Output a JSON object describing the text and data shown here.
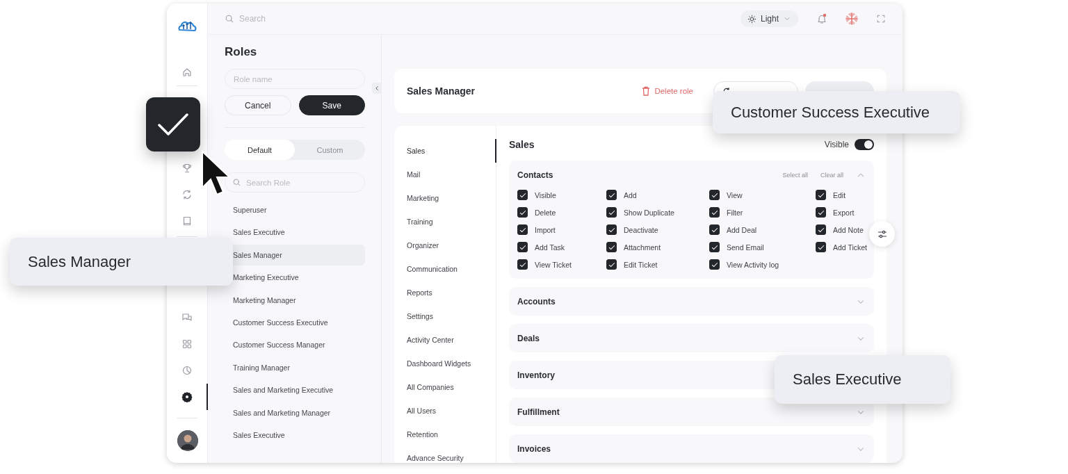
{
  "topbar": {
    "search_placeholder": "Search",
    "theme": "Light"
  },
  "rail_items": [
    {
      "selected": false
    },
    {
      "selected": false
    },
    {
      "selected": false
    },
    {
      "selected": false
    },
    {
      "selected": false
    },
    {
      "selected": false
    },
    {
      "selected": false
    },
    {
      "selected": true
    }
  ],
  "roles_panel": {
    "title": "Roles",
    "name_placeholder": "Role name",
    "buttons": [
      {
        "label": "Cancel",
        "kind": "secondary"
      },
      {
        "label": "Save",
        "kind": "primary"
      }
    ],
    "tabs": [
      {
        "label": "Default",
        "selected": true
      },
      {
        "label": "Custom",
        "selected": false
      }
    ],
    "search_placeholder": "Search Role",
    "roles": [
      {
        "label": "Superuser",
        "selected": false
      },
      {
        "label": "Sales Executive",
        "selected": false
      },
      {
        "label": "Sales Manager",
        "selected": true
      },
      {
        "label": "Marketing Executive",
        "selected": false
      },
      {
        "label": "Marketing Manager",
        "selected": false
      },
      {
        "label": "Customer Success Executive",
        "selected": false
      },
      {
        "label": "Customer Success Manager",
        "selected": false
      },
      {
        "label": "Training  Manager",
        "selected": false
      },
      {
        "label": "Sales and Marketing Executive",
        "selected": false
      },
      {
        "label": "Sales and Marketing Manager",
        "selected": false
      },
      {
        "label": "Sales Executive",
        "selected": false
      }
    ]
  },
  "role_header": {
    "title": "Sales Manager",
    "actions": [
      {
        "label": "Delete role",
        "kind": "danger"
      },
      {
        "kind": "outline"
      },
      {
        "kind": "disabled"
      }
    ]
  },
  "modules": [
    {
      "label": "Sales",
      "selected": true
    },
    {
      "label": "Mail",
      "selected": false
    },
    {
      "label": "Marketing",
      "selected": false
    },
    {
      "label": "Training",
      "selected": false
    },
    {
      "label": "Organizer",
      "selected": false
    },
    {
      "label": "Communication",
      "selected": false
    },
    {
      "label": "Reports",
      "selected": false
    },
    {
      "label": "Settings",
      "selected": false
    },
    {
      "label": "Activity Center",
      "selected": false
    },
    {
      "label": "Dashboard Widgets",
      "selected": false
    },
    {
      "label": "All Companies",
      "selected": false
    },
    {
      "label": "All Users",
      "selected": false
    },
    {
      "label": "Retention",
      "selected": false
    },
    {
      "label": "Advance Security",
      "selected": false
    }
  ],
  "section": {
    "title": "Sales",
    "visible_label": "Visible",
    "visible_on": true,
    "groups": [
      {
        "title": "Contacts",
        "expanded": true,
        "select_all": "Select all",
        "clear_all": "Clear all",
        "permissions": [
          {
            "label": "Visible",
            "checked": true
          },
          {
            "label": "Add",
            "checked": true
          },
          {
            "label": "View",
            "checked": true
          },
          {
            "label": "Edit",
            "checked": true
          },
          {
            "label": "Delete",
            "checked": true
          },
          {
            "label": "Show Duplicate",
            "checked": true
          },
          {
            "label": "Filter",
            "checked": true
          },
          {
            "label": "Export",
            "checked": true
          },
          {
            "label": "Import",
            "checked": true
          },
          {
            "label": "Deactivate",
            "checked": true
          },
          {
            "label": "Add Deal",
            "checked": true
          },
          {
            "label": "Add Note",
            "checked": true
          },
          {
            "label": "Add Task",
            "checked": true
          },
          {
            "label": "Attachment",
            "checked": true
          },
          {
            "label": "Send Email",
            "checked": true
          },
          {
            "label": "Add Ticket",
            "checked": true
          },
          {
            "label": "View Ticket",
            "checked": true
          },
          {
            "label": "Edit Ticket",
            "checked": true
          },
          {
            "label": "View Activity log",
            "checked": true
          }
        ]
      },
      {
        "title": "Accounts",
        "expanded": false
      },
      {
        "title": "Deals",
        "expanded": false
      },
      {
        "title": "Inventory"
      },
      {
        "title": "Fulfillment",
        "expanded": false
      },
      {
        "title": "Invoices",
        "expanded": false
      }
    ]
  },
  "overlays": [
    {
      "text": "Customer Success Executive"
    },
    {
      "text": "Sales Manager"
    },
    {
      "text": "Sales Executive"
    }
  ]
}
